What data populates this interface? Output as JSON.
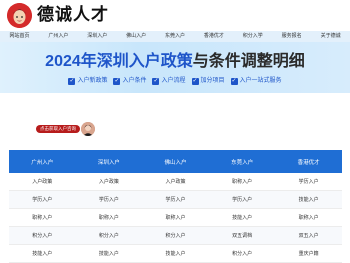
{
  "brand": {
    "name": "德诚人才"
  },
  "nav": [
    "网站首页",
    "广州入户",
    "深圳入户",
    "佛山入户",
    "东莞入户",
    "香港优才",
    "积分入学",
    "服务报名",
    "关于德诚"
  ],
  "banner": {
    "year": "2024年",
    "highlight": "深圳入户政策",
    "rest": "与条件调整明细",
    "tags": [
      "入户新政策",
      "入户条件",
      "入户流程",
      "加分项目",
      "入户一站式服务"
    ]
  },
  "consult": {
    "label": "点击获取入户咨询"
  },
  "table": {
    "headers": [
      "广州入户",
      "深圳入户",
      "佛山入户",
      "东莞入户",
      "香港优才"
    ],
    "rows": [
      [
        "入户政策",
        "入户政策",
        "入户政策",
        "职称入户",
        "学历入户"
      ],
      [
        "学历入户",
        "学历入户",
        "学历入户",
        "学历入户",
        "技能入户"
      ],
      [
        "职称入户",
        "职称入户",
        "职称入户",
        "技能入户",
        "职称入户"
      ],
      [
        "积分入户",
        "积分入户",
        "积分入户",
        "双五调档",
        "双五入户"
      ],
      [
        "技能入户",
        "技能入户",
        "技能入户",
        "积分入户",
        "重庆户籍"
      ]
    ]
  }
}
